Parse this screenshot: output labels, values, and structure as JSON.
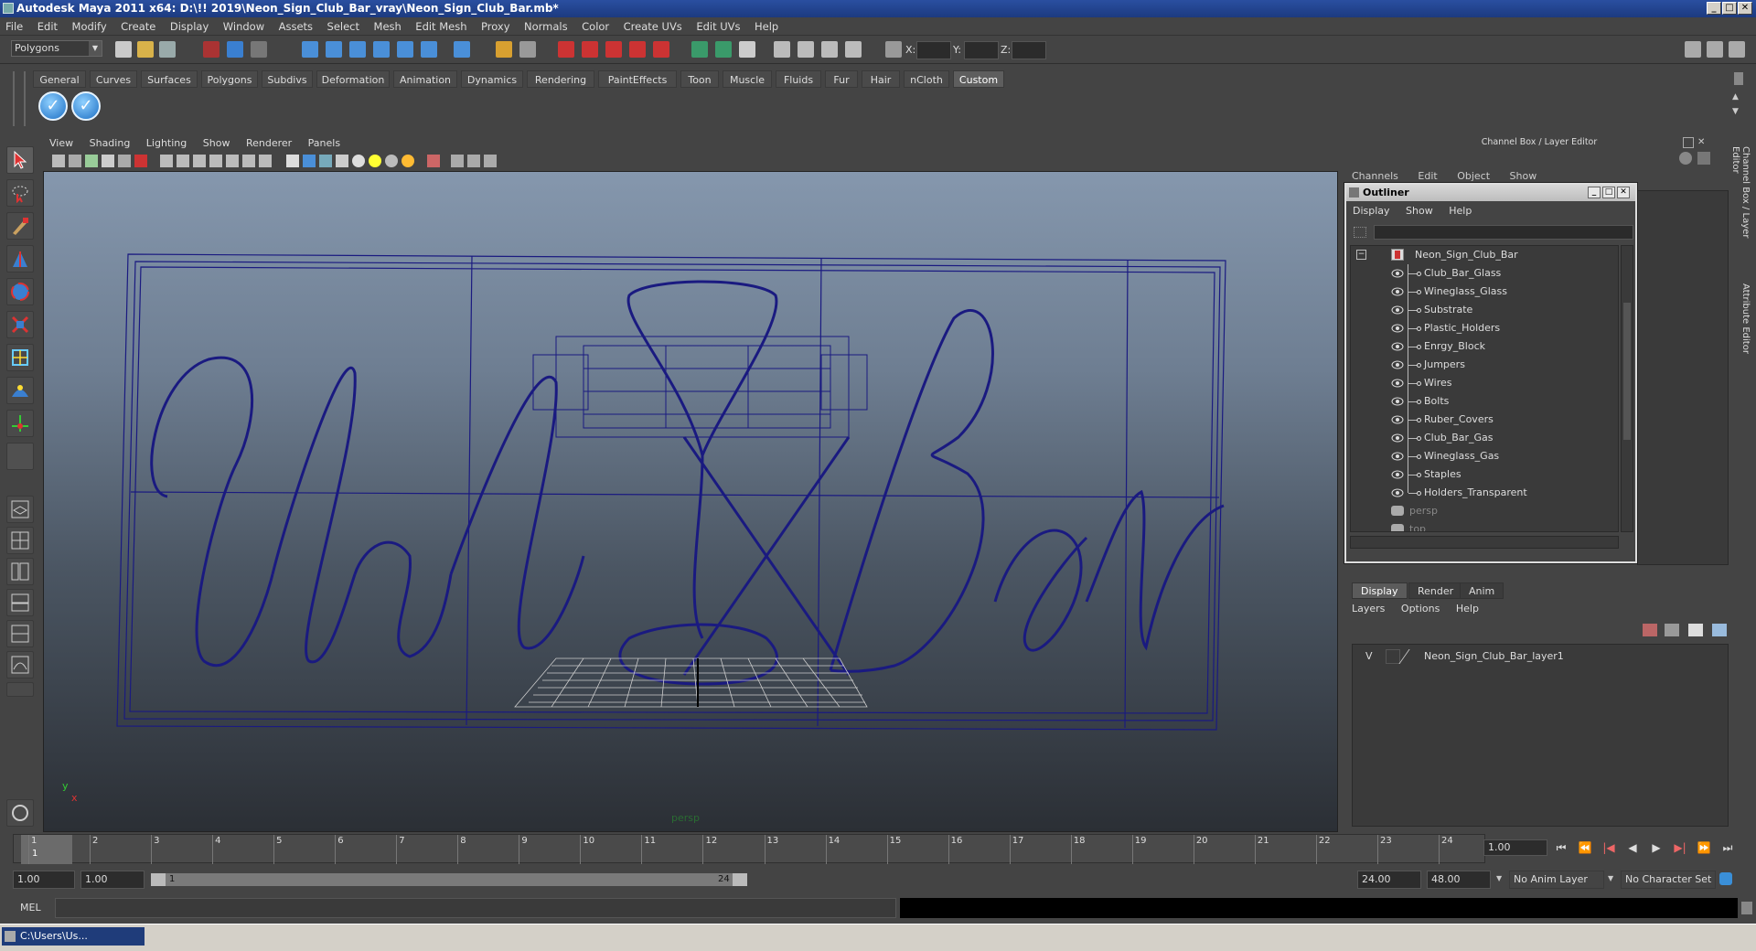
{
  "window": {
    "title": "Autodesk Maya 2011 x64: D:\\!! 2019\\Neon_Sign_Club_Bar_vray\\Neon_Sign_Club_Bar.mb*",
    "btn_min": "_",
    "btn_max": "□",
    "btn_close": "✕"
  },
  "menubar": [
    "File",
    "Edit",
    "Modify",
    "Create",
    "Display",
    "Window",
    "Assets",
    "Select",
    "Mesh",
    "Edit Mesh",
    "Proxy",
    "Normals",
    "Color",
    "Create UVs",
    "Edit UVs",
    "Help"
  ],
  "statusline": {
    "mode": "Polygons",
    "x_label": "X:",
    "y_label": "Y:",
    "z_label": "Z:"
  },
  "shelf": {
    "tabs": [
      "General",
      "Curves",
      "Surfaces",
      "Polygons",
      "Subdivs",
      "Deformation",
      "Animation",
      "Dynamics",
      "Rendering",
      "PaintEffects",
      "Toon",
      "Muscle",
      "Fluids",
      "Fur",
      "Hair",
      "nCloth",
      "Custom"
    ],
    "active_tab": "Custom",
    "check_glyph": "✓"
  },
  "viewport": {
    "menu": [
      "View",
      "Shading",
      "Lighting",
      "Show",
      "Renderer",
      "Panels"
    ],
    "camera_label": "persp",
    "axis_y": "y",
    "axis_x": "x",
    "wire_color": "#1a1a80"
  },
  "channelbox": {
    "title": "Channel Box / Layer Editor",
    "menu": [
      "Channels",
      "Edit",
      "Object",
      "Show"
    ],
    "side_tab_1": "Channel Box / Layer Editor",
    "side_tab_2": "Attribute Editor"
  },
  "outliner": {
    "title": "Outliner",
    "menu": [
      "Display",
      "Show",
      "Help"
    ],
    "root": "Neon_Sign_Club_Bar",
    "collapse_glyph": "−",
    "children": [
      "Club_Bar_Glass",
      "Wineglass_Glass",
      "Substrate",
      "Plastic_Holders",
      "Enrgy_Block",
      "Jumpers",
      "Wires",
      "Bolts",
      "Ruber_Covers",
      "Club_Bar_Gas",
      "Wineglass_Gas",
      "Staples",
      "Holders_Transparent"
    ],
    "cameras": [
      "persp",
      "top"
    ]
  },
  "layers": {
    "tabs": [
      "Display",
      "Render",
      "Anim"
    ],
    "active_tab": "Display",
    "menu": [
      "Layers",
      "Options",
      "Help"
    ],
    "layer_visible": "V",
    "layer_name": "Neon_Sign_Club_Bar_layer1"
  },
  "timeline": {
    "ticks": [
      "1",
      "2",
      "3",
      "4",
      "5",
      "6",
      "7",
      "8",
      "9",
      "10",
      "11",
      "12",
      "13",
      "14",
      "15",
      "16",
      "17",
      "18",
      "19",
      "20",
      "21",
      "22",
      "23",
      "24"
    ],
    "current_frame_value": "1",
    "current_frame_field": "1.00",
    "playback_buttons": [
      "⏮",
      "⏪",
      "|◀",
      "◀",
      "▶",
      "▶|",
      "⏩",
      "⏭"
    ]
  },
  "range": {
    "start_field": "1.00",
    "range_start": "1.00",
    "slider_start": "1",
    "slider_end": "24",
    "range_end": "24.00",
    "end_field": "48.00",
    "anim_layer": "No Anim Layer",
    "character_set": "No Character Set"
  },
  "cmdline": {
    "label": "MEL"
  },
  "taskbar": {
    "item": "C:\\Users\\Us..."
  },
  "colors": {
    "title_bar": "#1c3a80",
    "shelf_button": "#1c6fc4",
    "wire": "#1a1a80"
  }
}
